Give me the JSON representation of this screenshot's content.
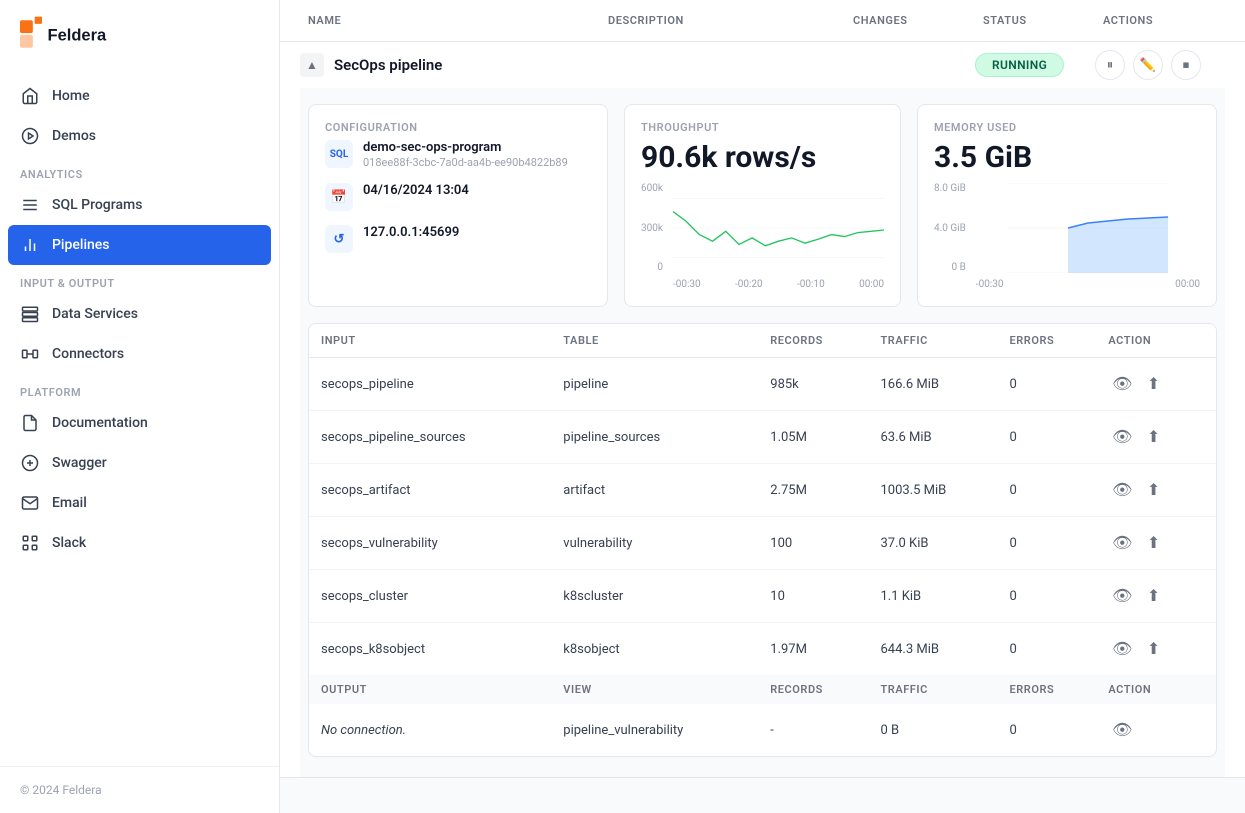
{
  "sidebar": {
    "logo_text": "Feldera",
    "nav_items": [
      {
        "id": "home",
        "label": "Home",
        "icon": "home"
      },
      {
        "id": "demos",
        "label": "Demos",
        "icon": "demos"
      }
    ],
    "analytics_label": "ANALYTICS",
    "analytics_items": [
      {
        "id": "sql-programs",
        "label": "SQL Programs",
        "icon": "sql"
      },
      {
        "id": "pipelines",
        "label": "Pipelines",
        "icon": "pipelines",
        "active": true
      }
    ],
    "input_output_label": "INPUT & OUTPUT",
    "io_items": [
      {
        "id": "data-services",
        "label": "Data Services",
        "icon": "data-services"
      },
      {
        "id": "connectors",
        "label": "Connectors",
        "icon": "connectors"
      }
    ],
    "platform_label": "PLATFORM",
    "platform_items": [
      {
        "id": "documentation",
        "label": "Documentation",
        "icon": "doc"
      },
      {
        "id": "swagger",
        "label": "Swagger",
        "icon": "swagger"
      },
      {
        "id": "email",
        "label": "Email",
        "icon": "email"
      },
      {
        "id": "slack",
        "label": "Slack",
        "icon": "slack"
      }
    ],
    "footer": "© 2024 Feldera"
  },
  "header": {
    "columns": [
      "NAME",
      "DESCRIPTION",
      "CHANGES",
      "STATUS",
      "ACTIONS"
    ]
  },
  "pipeline": {
    "name": "SecOps pipeline",
    "status": "RUNNING",
    "config": {
      "section_label": "CONFIGURATION",
      "program_name": "demo-sec-ops-program",
      "program_id": "018ee88f-3cbc-7a0d-aa4b-ee90b4822b89",
      "date": "04/16/2024 13:04",
      "address": "127.0.0.1:45699"
    },
    "throughput": {
      "label": "Throughput",
      "value": "90.6k rows/s",
      "y_labels": [
        "600k",
        "300k",
        "0"
      ],
      "x_labels": [
        "-00:30",
        "-00:20",
        "-00:10",
        "00:00"
      ]
    },
    "memory": {
      "label": "Memory used",
      "value": "3.5 GiB",
      "y_labels": [
        "8.0 GiB",
        "4.0 GiB",
        "0 B"
      ],
      "x_labels": [
        "-00:30",
        "",
        "",
        "00:00"
      ]
    },
    "input_columns": [
      "INPUT",
      "TABLE",
      "RECORDS",
      "TRAFFIC",
      "ERRORS",
      "ACTION"
    ],
    "input_rows": [
      {
        "input": "secops_pipeline",
        "table": "pipeline",
        "records": "985k",
        "traffic": "166.6 MiB",
        "errors": "0"
      },
      {
        "input": "secops_pipeline_sources",
        "table": "pipeline_sources",
        "records": "1.05M",
        "traffic": "63.6 MiB",
        "errors": "0"
      },
      {
        "input": "secops_artifact",
        "table": "artifact",
        "records": "2.75M",
        "traffic": "1003.5 MiB",
        "errors": "0"
      },
      {
        "input": "secops_vulnerability",
        "table": "vulnerability",
        "records": "100",
        "traffic": "37.0 KiB",
        "errors": "0"
      },
      {
        "input": "secops_cluster",
        "table": "k8scluster",
        "records": "10",
        "traffic": "1.1 KiB",
        "errors": "0"
      },
      {
        "input": "secops_k8sobject",
        "table": "k8sobject",
        "records": "1.97M",
        "traffic": "644.3 MiB",
        "errors": "0"
      }
    ],
    "output_columns": [
      "OUTPUT",
      "VIEW",
      "RECORDS",
      "TRAFFIC",
      "ERRORS",
      "ACTION"
    ],
    "output_rows": [
      {
        "output": "No connection.",
        "view": "pipeline_vulnerability",
        "records": "-",
        "traffic": "0 B",
        "errors": "0"
      }
    ]
  }
}
